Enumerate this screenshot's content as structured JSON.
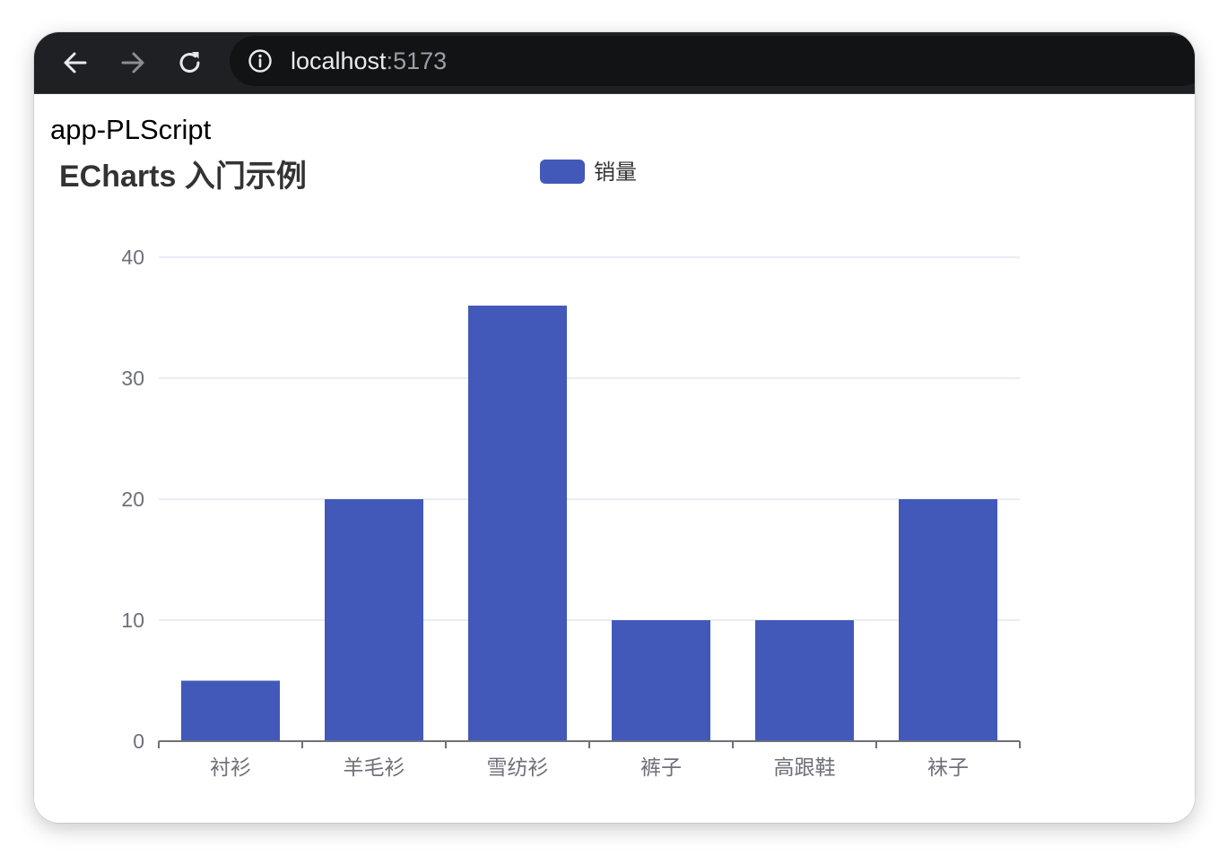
{
  "browser": {
    "url_host": "localhost",
    "url_port": ":5173",
    "back_icon": "arrow-left-icon",
    "forward_icon": "arrow-right-icon",
    "reload_icon": "reload-icon",
    "info_icon": "info-icon",
    "colors": {
      "toolbar": "#1f2023",
      "omnibox": "#121315",
      "url_text": "#e8eaed",
      "url_port": "#9aa0a6"
    }
  },
  "page": {
    "app_title": "app-PLScript"
  },
  "chart_data": {
    "type": "bar",
    "title": "ECharts 入门示例",
    "categories": [
      "衬衫",
      "羊毛衫",
      "雪纺衫",
      "裤子",
      "高跟鞋",
      "袜子"
    ],
    "series": [
      {
        "name": "销量",
        "values": [
          5,
          20,
          36,
          10,
          10,
          20
        ]
      }
    ],
    "ylim": [
      0,
      40
    ],
    "yticks": [
      0,
      10,
      20,
      30,
      40
    ],
    "grid": true,
    "legend_position": "top-center",
    "colors": {
      "bar": "#4259b9",
      "grid": "#e0e6f1",
      "axis": "#6e7079",
      "title": "#333333"
    }
  }
}
